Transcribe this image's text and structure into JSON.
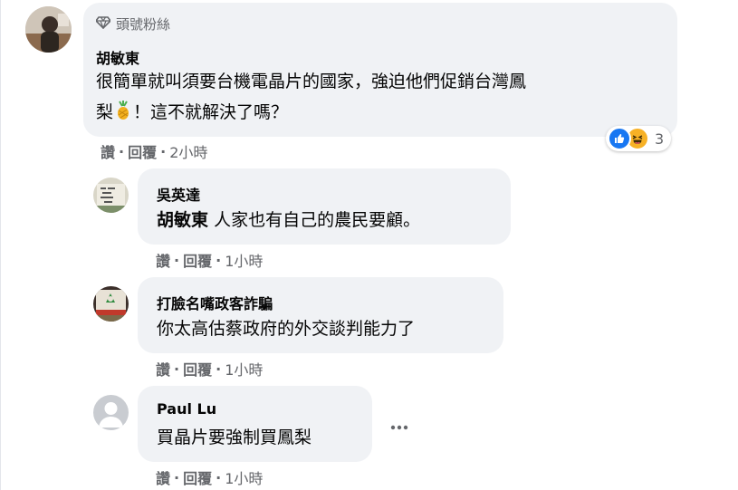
{
  "comment": {
    "badge_label": "頭號粉絲",
    "author": "胡敏東",
    "text_line1": "很簡單就叫須要台機電晶片的國家，強迫他們促銷台灣鳳",
    "text_line2_pre": "梨",
    "text_line2_post": "！這不就解決了嗎？",
    "reaction_count": "3",
    "actions": {
      "like": "讚",
      "reply": "回覆",
      "time": "2小時",
      "sep": "·"
    }
  },
  "replies": [
    {
      "author": "吳英達",
      "tag": "胡敏東",
      "text": "人家也有自己的農民要顧。",
      "actions": {
        "like": "讚",
        "reply": "回覆",
        "time": "1小時",
        "sep": "·"
      }
    },
    {
      "author": "打臉名嘴政客詐騙",
      "text": "你太高估蔡政府的外交談判能力了",
      "actions": {
        "like": "讚",
        "reply": "回覆",
        "time": "1小時",
        "sep": "·"
      }
    },
    {
      "author": "Paul Lu",
      "text": "買晶片要強制買鳳梨",
      "actions": {
        "like": "讚",
        "reply": "回覆",
        "time": "1小時",
        "sep": "·"
      }
    }
  ],
  "icons": {
    "badge": "diamond-icon",
    "emoji": "pineapple-icon",
    "reaction1": "like-icon",
    "reaction2": "haha-icon",
    "more": "more-options-icon"
  },
  "colors": {
    "bubble": "#f0f2f5",
    "meta": "#65676b",
    "like": "#1877f2",
    "haha": "#f7b125"
  }
}
